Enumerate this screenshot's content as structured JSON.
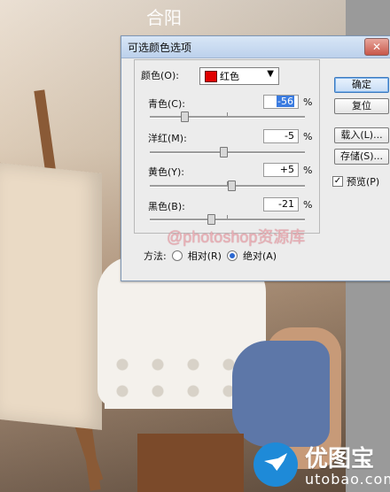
{
  "background": {
    "top_logo": "合阳"
  },
  "dialog": {
    "title": "可选颜色选项",
    "close_symbol": "✕",
    "color_label": "颜色(O):",
    "color_value": "红色",
    "swatch_color": "#e00000",
    "sliders": [
      {
        "label": "青色(C):",
        "value": "-56",
        "selected": true,
        "level": -56
      },
      {
        "label": "洋红(M):",
        "value": "-5",
        "selected": false,
        "level": -5
      },
      {
        "label": "黄色(Y):",
        "value": "+5",
        "selected": false,
        "level": 5
      },
      {
        "label": "黑色(B):",
        "value": "-21",
        "selected": false,
        "level": -21
      }
    ],
    "percent": "%",
    "method_label": "方法:",
    "method_options": [
      "相对(R)",
      "绝对(A)"
    ],
    "method_selected": "绝对(A)",
    "buttons": {
      "ok": "确定",
      "reset": "复位",
      "load": "载入(L)...",
      "save": "存储(S)..."
    },
    "preview_label": "预览(P)",
    "preview_checked": true
  },
  "watermark": "@photoshop资源库",
  "brand": {
    "name_cn": "优图宝",
    "name_en": "utobao.com"
  }
}
